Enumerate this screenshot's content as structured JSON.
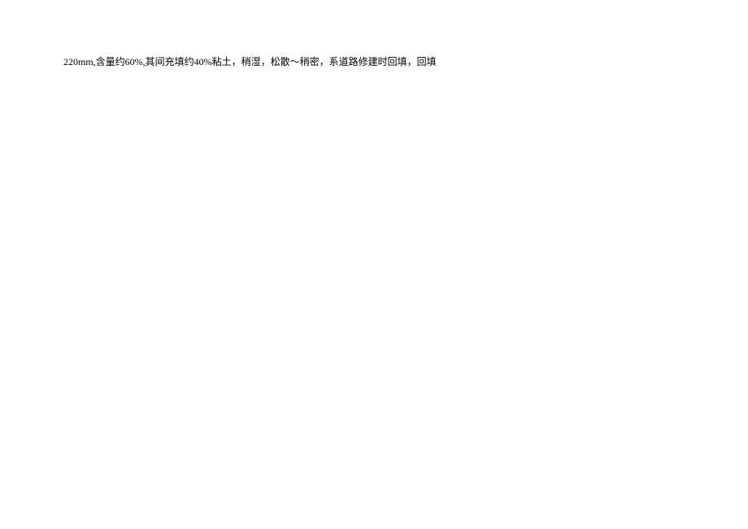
{
  "document": {
    "body_text": "220mm,含量约60%,其间充填约40%粘土，稍湿，松散～稍密，系道路修建时回填，回填"
  }
}
